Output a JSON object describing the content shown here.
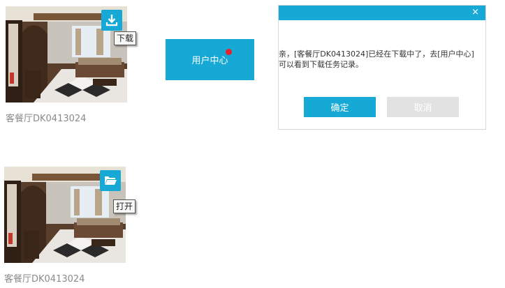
{
  "cards": [
    {
      "name": "客餐厅DK0413024",
      "action_icon": "download-icon",
      "tooltip": "下载"
    },
    {
      "name": "客餐厅DK0413024",
      "action_icon": "folder-icon",
      "tooltip": "打开"
    }
  ],
  "user_center": {
    "label": "用户中心",
    "has_notification_dot": true
  },
  "dialog": {
    "close_glyph": "×",
    "message_line1": "亲，[客餐厅DK0413024]已经在下载中了，去[用户中心]",
    "message_line2": "可以看到下载任务记录。",
    "ok_label": "确定",
    "cancel_label": "取消"
  },
  "colors": {
    "accent": "#16a9d6",
    "notification_dot": "#e8222d",
    "disabled_button": "#e2e2e2",
    "caption_text": "#8a8a8a"
  }
}
